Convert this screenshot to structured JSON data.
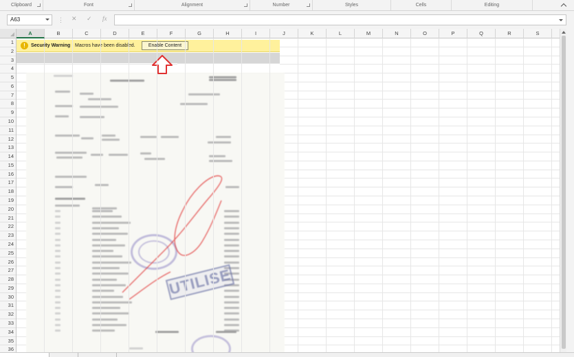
{
  "ribbon": {
    "groups": [
      "Clipboard",
      "Font",
      "Alignment",
      "Number",
      "Styles",
      "Cells",
      "Editing"
    ]
  },
  "formula_bar": {
    "name_box": "A63",
    "cancel_icon": "✕",
    "enter_icon": "✓",
    "fx_label": "fx",
    "formula": ""
  },
  "columns": [
    "A",
    "B",
    "C",
    "D",
    "E",
    "F",
    "G",
    "H",
    "I",
    "J",
    "K",
    "L",
    "M",
    "N",
    "O",
    "P",
    "Q",
    "R",
    "S"
  ],
  "selected_column": "A",
  "rows": [
    "1",
    "2",
    "3",
    "4",
    "5",
    "6",
    "7",
    "8",
    "9",
    "10",
    "11",
    "12",
    "13",
    "14",
    "15",
    "16",
    "17",
    "18",
    "19",
    "20",
    "21",
    "22",
    "23",
    "24",
    "25",
    "26",
    "27",
    "28",
    "29",
    "30",
    "31",
    "32",
    "33",
    "34",
    "35",
    "36"
  ],
  "security_bar": {
    "title": "Security Warning",
    "message": "Macros have been disabled.",
    "button": "Enable Content",
    "colors": {
      "bar": "#fff19c",
      "icon": "#e8b600"
    }
  },
  "embedded_image": {
    "stamp_text": "UTILISE",
    "annotation_color": "#e03030",
    "arrow_color": "#e03030"
  }
}
